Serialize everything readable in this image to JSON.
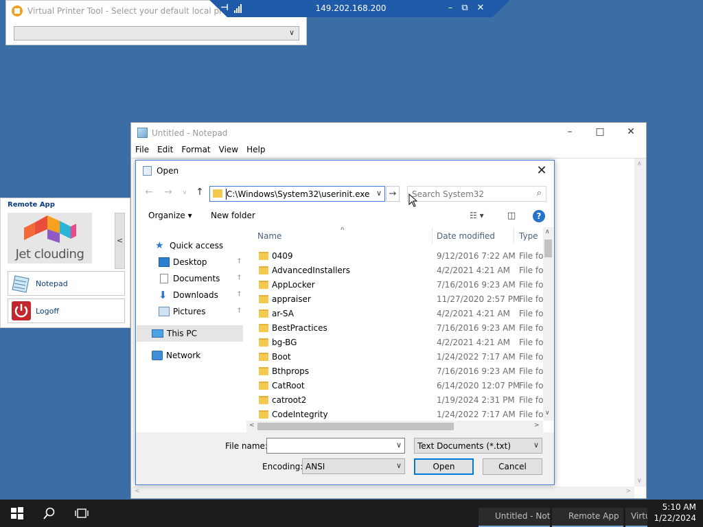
{
  "virtual_printer": {
    "title": "Virtual Printer Tool - Select your default local printer",
    "selected": ""
  },
  "rdp_bar": {
    "host": "149.202.168.200"
  },
  "remote_app": {
    "title": "Remote App",
    "logo_text": "Jet clouding",
    "collapse_glyph": "<",
    "apps": [
      {
        "label": "Notepad"
      },
      {
        "label": "Logoff"
      }
    ]
  },
  "notepad": {
    "title": "Untitled - Notepad",
    "menu": [
      "File",
      "Edit",
      "Format",
      "View",
      "Help"
    ]
  },
  "open_dialog": {
    "title": "Open",
    "address": "C:\\Windows\\System32\\userinit.exe",
    "search_placeholder": "Search System32",
    "organize_label": "Organize",
    "new_folder_label": "New folder",
    "sidebar": [
      {
        "label": "Quick access",
        "icon": "star-icon"
      },
      {
        "label": "Desktop",
        "icon": "desktop-icon",
        "pinned": true
      },
      {
        "label": "Documents",
        "icon": "documents-icon",
        "pinned": true
      },
      {
        "label": "Downloads",
        "icon": "downloads-icon",
        "pinned": true
      },
      {
        "label": "Pictures",
        "icon": "pictures-icon",
        "pinned": true
      },
      {
        "label": "This PC",
        "icon": "computer-icon",
        "selected": true
      },
      {
        "label": "Network",
        "icon": "network-icon"
      }
    ],
    "columns": [
      "Name",
      "Date modified",
      "Type"
    ],
    "files": [
      {
        "name": "0409",
        "date": "9/12/2016 7:22 AM",
        "type": "File fol"
      },
      {
        "name": "AdvancedInstallers",
        "date": "4/2/2021 4:21 AM",
        "type": "File fol"
      },
      {
        "name": "AppLocker",
        "date": "7/16/2016 9:23 AM",
        "type": "File fol"
      },
      {
        "name": "appraiser",
        "date": "11/27/2020 2:57 PM",
        "type": "File fol"
      },
      {
        "name": "ar-SA",
        "date": "4/2/2021 4:21 AM",
        "type": "File fol"
      },
      {
        "name": "BestPractices",
        "date": "7/16/2016 9:23 AM",
        "type": "File fol"
      },
      {
        "name": "bg-BG",
        "date": "4/2/2021 4:21 AM",
        "type": "File fol"
      },
      {
        "name": "Boot",
        "date": "1/24/2022 7:17 AM",
        "type": "File fol"
      },
      {
        "name": "Bthprops",
        "date": "7/16/2016 9:23 AM",
        "type": "File fol"
      },
      {
        "name": "CatRoot",
        "date": "6/14/2020 12:07 PM",
        "type": "File fol"
      },
      {
        "name": "catroot2",
        "date": "1/19/2024 2:31 PM",
        "type": "File fol"
      },
      {
        "name": "CodeIntegrity",
        "date": "1/24/2022 7:17 AM",
        "type": "File fol"
      }
    ],
    "file_name_label": "File name:",
    "file_name_value": "",
    "file_type": "Text Documents (*.txt)",
    "encoding_label": "Encoding:",
    "encoding_value": "ANSI",
    "open_label": "Open",
    "cancel_label": "Cancel"
  },
  "taskbar": {
    "tasks": [
      "Untitled - Note",
      "Remote App",
      "Virtu"
    ],
    "time": "5:10 AM",
    "date": "1/22/2024"
  },
  "colors": {
    "desktop": "#3a6ea5",
    "accent": "#0078d7",
    "taskbar": "#1c1c1c",
    "folder": "#f3c94f"
  }
}
